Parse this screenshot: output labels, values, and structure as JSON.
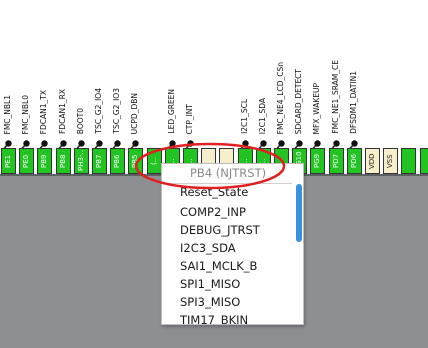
{
  "pins": [
    {
      "label": "FMC_NBL1",
      "pin": "PE1",
      "type": "signal"
    },
    {
      "label": "FMC_NBL0",
      "pin": "PE0",
      "type": "signal"
    },
    {
      "label": "FDCAN1_TX",
      "pin": "PB9",
      "type": "signal"
    },
    {
      "label": "FDCAN1_RX",
      "pin": "PB8",
      "type": "signal"
    },
    {
      "label": "BOOT0",
      "pin": "PH3-..",
      "type": "signal"
    },
    {
      "label": "TSC_G2_IO4",
      "pin": "PB7",
      "type": "signal"
    },
    {
      "label": "TSC_G2_IO3",
      "pin": "PB6",
      "type": "signal"
    },
    {
      "label": "UCPD_DBN",
      "pin": "PB5",
      "type": "signal"
    },
    {
      "label": "",
      "pin": "(..",
      "type": "signal"
    },
    {
      "label": "LED_GREEN",
      "pin": "..",
      "type": "signal"
    },
    {
      "label": "CTP_INT",
      "pin": "..",
      "type": "signal"
    },
    {
      "label": "",
      "pin": "",
      "type": "power"
    },
    {
      "label": "",
      "pin": "",
      "type": "power"
    },
    {
      "label": "I2C1_SCL",
      "pin": "..",
      "type": "signal"
    },
    {
      "label": "I2C1_SDA",
      "pin": "..",
      "type": "signal"
    },
    {
      "label": "FMC_NE4_LCD_CSn",
      "pin": "..",
      "type": "signal"
    },
    {
      "label": "SDCARD_DETECT",
      "pin": "PG10",
      "type": "signal"
    },
    {
      "label": "MFX_WAKEUP",
      "pin": "PG9",
      "type": "signal"
    },
    {
      "label": "FMC_NE1_SRAM_CE",
      "pin": "PD7",
      "type": "signal"
    },
    {
      "label": "DFSDM1_DATIN1",
      "pin": "PD6",
      "type": "signal"
    },
    {
      "label": "",
      "pin": "VDD",
      "type": "power"
    },
    {
      "label": "",
      "pin": "VSS",
      "type": "power"
    },
    {
      "label": "",
      "pin": "",
      "type": "signal"
    },
    {
      "label": "",
      "pin": "",
      "type": "signal"
    }
  ],
  "menu": {
    "header": "PB4 (NJTRST)",
    "items": [
      "Reset_State",
      "COMP2_INP",
      "DEBUG_JTRST",
      "I2C3_SDA",
      "SAI1_MCLK_B",
      "SPI1_MISO",
      "SPI3_MISO",
      "TIM17_BKIN"
    ]
  },
  "colors": {
    "pin_signal": "#21c421",
    "pin_power": "#f7eecb",
    "chip_body": "#8d8f93",
    "highlight": "#e02020",
    "scrollbar": "#3b8fe0"
  }
}
